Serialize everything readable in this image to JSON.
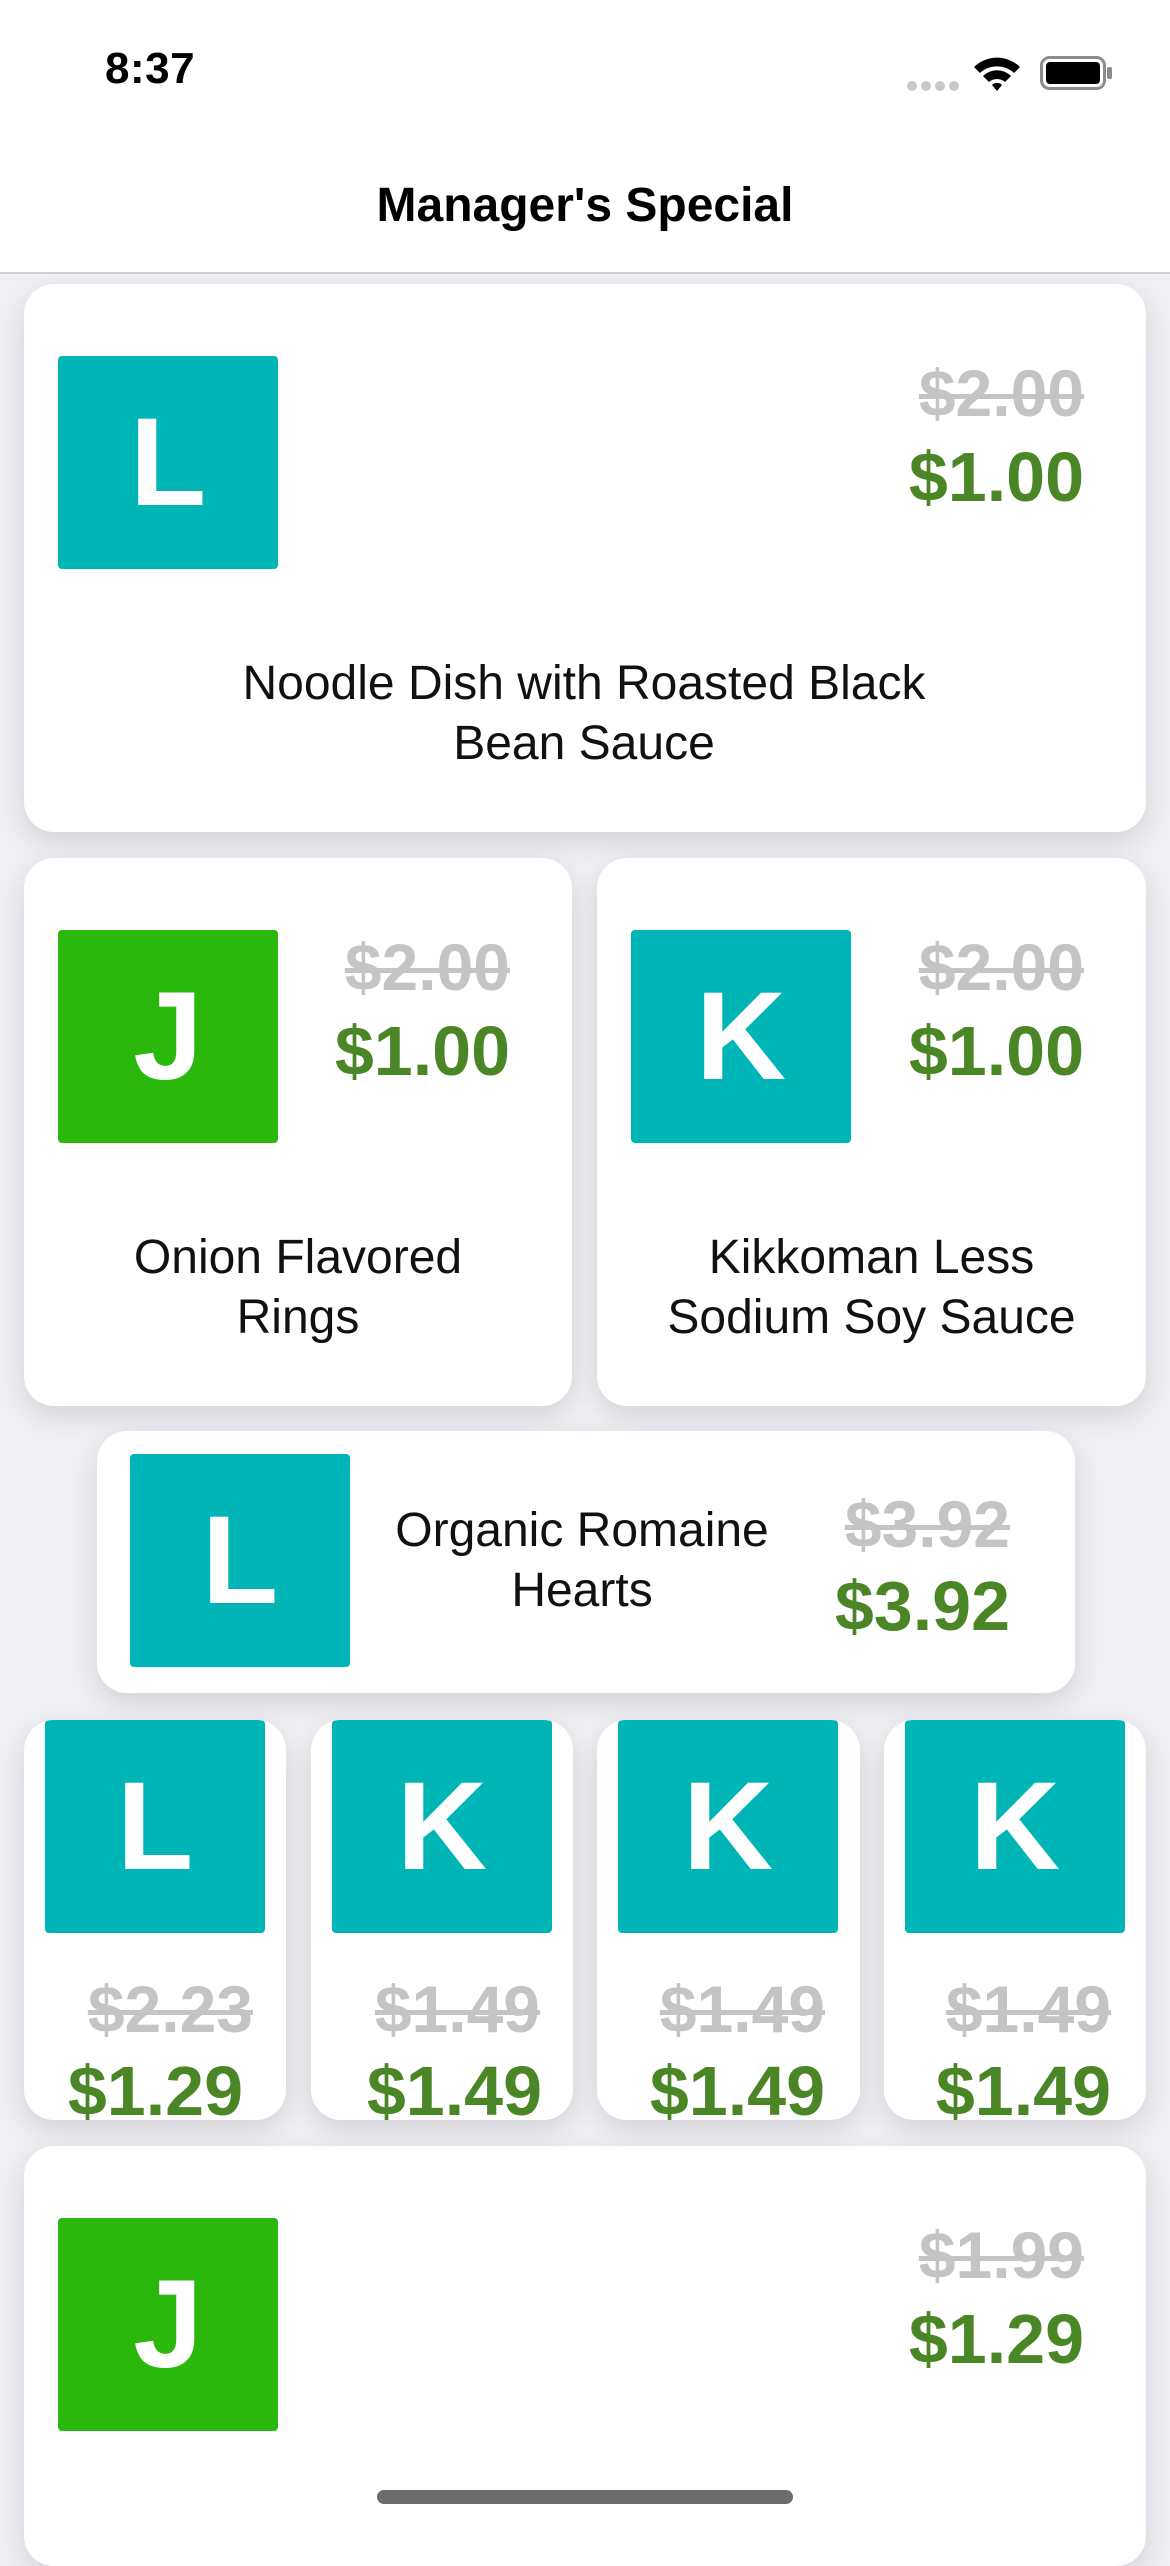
{
  "status": {
    "time": "8:37"
  },
  "nav": {
    "title": "Manager's Special"
  },
  "products": [
    {
      "letter": "L",
      "color": "#00b5b5",
      "original_price": "$2.00",
      "price": "$1.00",
      "name": "Noodle Dish with Roasted Black Bean Sauce"
    },
    {
      "letter": "J",
      "color": "#2bb80c",
      "original_price": "$2.00",
      "price": "$1.00",
      "name": "Onion Flavored Rings"
    },
    {
      "letter": "K",
      "color": "#00b5b5",
      "original_price": "$2.00",
      "price": "$1.00",
      "name": "Kikkoman Less Sodium Soy Sauce"
    },
    {
      "letter": "L",
      "color": "#00b5b5",
      "original_price": "$3.92",
      "price": "$3.92",
      "name": "Organic Romaine Hearts"
    },
    {
      "letter": "L",
      "color": "#00b5b5",
      "original_price": "$2.23",
      "price": "$1.29"
    },
    {
      "letter": "K",
      "color": "#00b5b5",
      "original_price": "$1.49",
      "price": "$1.49"
    },
    {
      "letter": "K",
      "color": "#00b5b5",
      "original_price": "$1.49",
      "price": "$1.49"
    },
    {
      "letter": "K",
      "color": "#00b5b5",
      "original_price": "$1.49",
      "price": "$1.49"
    },
    {
      "letter": "J",
      "color": "#2bb80c",
      "original_price": "$1.99",
      "price": "$1.29"
    }
  ],
  "icons": [
    "cellular-signal-icon",
    "wifi-icon",
    "battery-icon"
  ]
}
